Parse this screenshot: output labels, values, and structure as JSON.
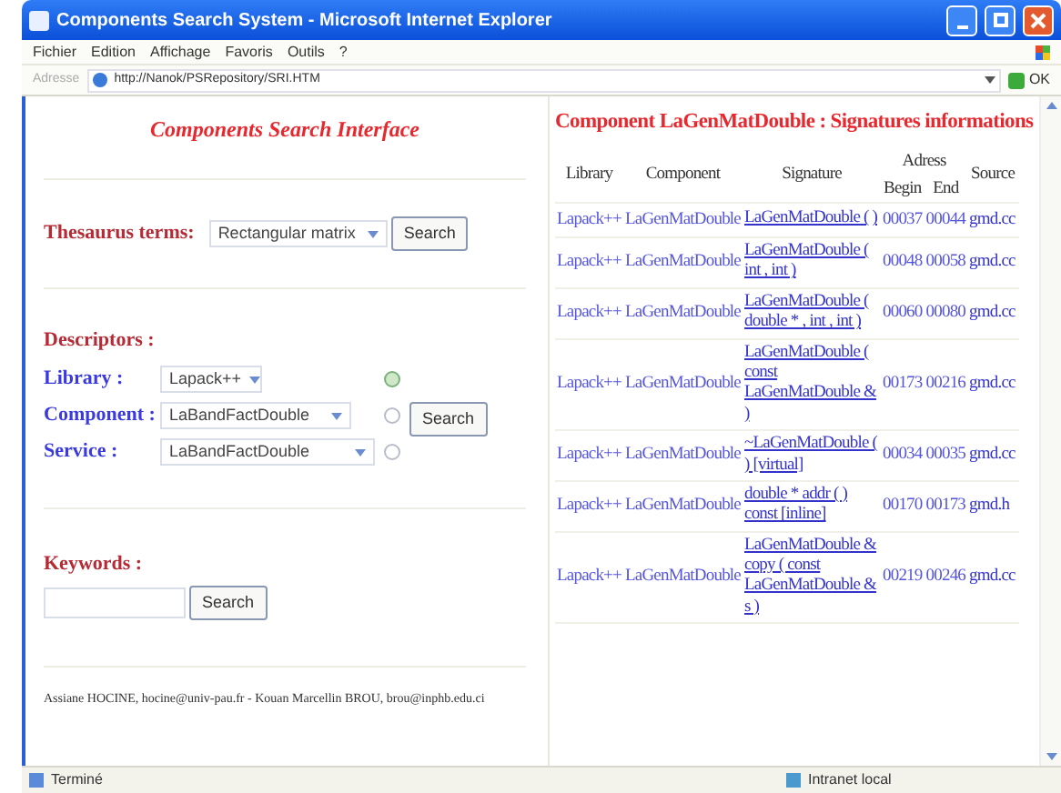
{
  "window": {
    "title": "Components Search System - Microsoft Internet Explorer"
  },
  "menu": [
    "Fichier",
    "Edition",
    "Affichage",
    "Favoris",
    "Outils",
    "?"
  ],
  "address_bar": {
    "label": "Adresse",
    "url": "http://Nanok/PSRepository/SRI.HTM",
    "go": "OK"
  },
  "search_panel": {
    "title": "Components Search Interface",
    "thesaurus": {
      "label": "Thesaurus terms:",
      "value": "Rectangular matrix",
      "button": "Search"
    },
    "descriptors": {
      "heading": "Descriptors :",
      "button": "Search",
      "rows": [
        {
          "label": "Library :",
          "value": "Lapack++",
          "selected": true
        },
        {
          "label": "Component :",
          "value": "LaBandFactDouble",
          "selected": false
        },
        {
          "label": "Service :",
          "value": "LaBandFactDouble",
          "selected": false
        }
      ]
    },
    "keywords": {
      "label": "Keywords :",
      "button": "Search"
    },
    "footer": "Assiane HOCINE, hocine@univ-pau.fr - Kouan Marcellin BROU, brou@inphb.edu.ci"
  },
  "signatures": {
    "title": "Component LaGenMatDouble : Signatures informations",
    "columns": {
      "library": "Library",
      "component": "Component",
      "signature": "Signature",
      "address": "Adress",
      "begin": "Begin",
      "end": "End",
      "source": "Source"
    },
    "rows": [
      {
        "library": "Lapack++",
        "component": "LaGenMatDouble",
        "signature": "LaGenMatDouble ( )",
        "begin": "00037",
        "end": "00044",
        "source": "gmd.cc"
      },
      {
        "library": "Lapack++",
        "component": "LaGenMatDouble",
        "signature": "LaGenMatDouble ( int , int )",
        "begin": "00048",
        "end": "00058",
        "source": "gmd.cc"
      },
      {
        "library": "Lapack++",
        "component": "LaGenMatDouble",
        "signature": "LaGenMatDouble ( double * , int , int )",
        "begin": "00060",
        "end": "00080",
        "source": "gmd.cc"
      },
      {
        "library": "Lapack++",
        "component": "LaGenMatDouble",
        "signature": "LaGenMatDouble ( const LaGenMatDouble & )",
        "begin": "00173",
        "end": "00216",
        "source": "gmd.cc"
      },
      {
        "library": "Lapack++",
        "component": "LaGenMatDouble",
        "signature": "~LaGenMatDouble ( ) [virtual]",
        "begin": "00034",
        "end": "00035",
        "source": "gmd.cc"
      },
      {
        "library": "Lapack++",
        "component": "LaGenMatDouble",
        "signature": "double * addr ( ) const [inline]",
        "begin": "00170",
        "end": "00173",
        "source": "gmd.h"
      },
      {
        "library": "Lapack++",
        "component": "LaGenMatDouble",
        "signature": "LaGenMatDouble & copy ( const LaGenMatDouble & s )",
        "begin": "00219",
        "end": "00246",
        "source": "gmd.cc"
      }
    ]
  },
  "status_bar": {
    "text": "Terminé",
    "zone": "Intranet local"
  }
}
